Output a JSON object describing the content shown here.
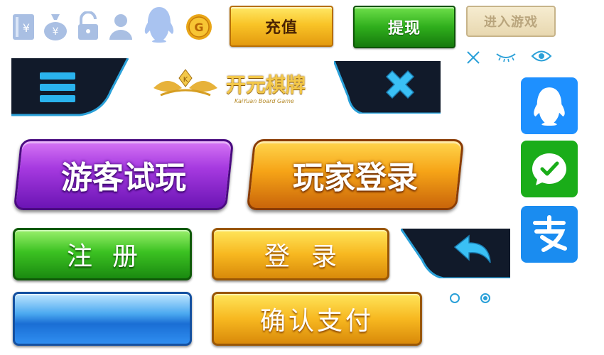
{
  "top_buttons": {
    "recharge": "充值",
    "withdraw": "提现",
    "enter_game": "进入游戏"
  },
  "logo": {
    "title": "开元棋牌",
    "subtitle": "KaiYuan Board Game"
  },
  "main_buttons": {
    "guest": "游客试玩",
    "player_login": "玩家登录",
    "register": "注册",
    "login": "登录",
    "confirm_pay": "确认支付"
  },
  "colors": {
    "accent_blue": "#2aa0d8",
    "qq_blue": "#1e90ff",
    "wechat_green": "#1aad19",
    "alipay_blue": "#1a8cf0"
  },
  "icons": {
    "top_row": [
      "receipt-icon",
      "money-bag-icon",
      "unlock-icon",
      "user-icon",
      "qq-penguin-icon",
      "gold-coin-icon"
    ],
    "utility": [
      "close-icon",
      "eye-closed-icon",
      "eye-open-icon"
    ],
    "social": [
      "qq-icon",
      "wechat-icon",
      "alipay-icon"
    ]
  },
  "radio": {
    "selected_index": 1
  }
}
